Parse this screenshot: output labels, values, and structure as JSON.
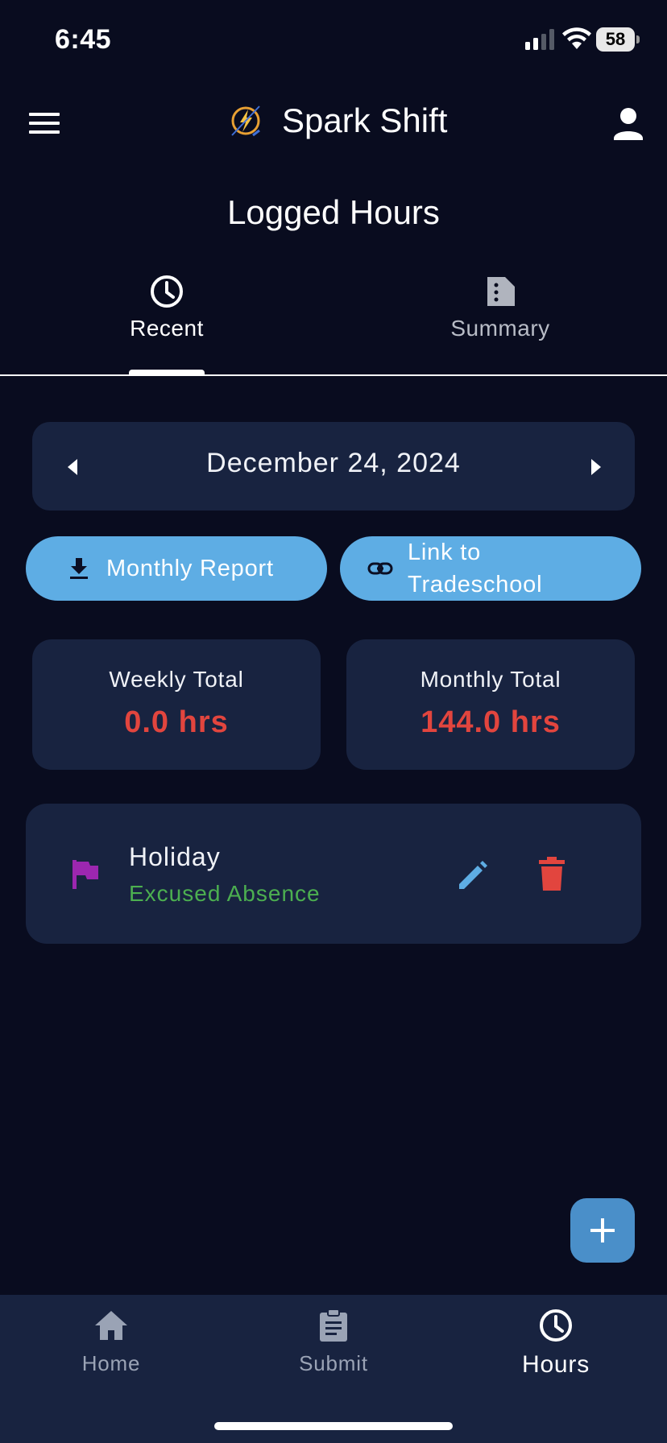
{
  "status_bar": {
    "time": "6:45",
    "battery": "58"
  },
  "header": {
    "app_name": "Spark Shift"
  },
  "page": {
    "title": "Logged Hours"
  },
  "tabs": [
    {
      "label": "Recent",
      "icon": "clock-icon",
      "active": true
    },
    {
      "label": "Summary",
      "icon": "document-icon",
      "active": false
    }
  ],
  "date_selector": {
    "date": "December 24, 2024"
  },
  "actions": {
    "monthly_report": "Monthly Report",
    "link_line1": "Link to",
    "link_line2": "Tradeschool"
  },
  "totals": {
    "weekly_label": "Weekly Total",
    "weekly_value": "0.0 hrs",
    "monthly_label": "Monthly Total",
    "monthly_value": "144.0 hrs"
  },
  "entries": [
    {
      "title": "Holiday",
      "subtitle": "Excused Absence",
      "icon": "flag-icon"
    }
  ],
  "bottom_nav": [
    {
      "label": "Home",
      "icon": "home-icon",
      "active": false
    },
    {
      "label": "Submit",
      "icon": "clipboard-icon",
      "active": false
    },
    {
      "label": "Hours",
      "icon": "clock-icon",
      "active": true
    }
  ],
  "colors": {
    "background": "#090c1f",
    "card": "#182340",
    "accent_button": "#5eade4",
    "fab": "#4a8fc9",
    "total_value": "#e2453e",
    "subtitle_green": "#4caf50",
    "flag_purple": "#9c27b0",
    "edit_blue": "#5eade4",
    "delete_red": "#e2453e"
  }
}
